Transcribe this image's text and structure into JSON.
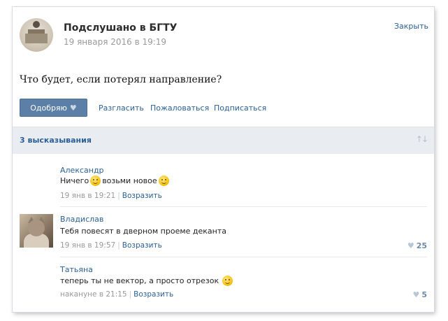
{
  "post": {
    "group_name": "Подслушано в БГТУ",
    "date": "19 января 2016 в 19:19",
    "close_label": "Закрыть",
    "text": "Что будет, если потерял направление?",
    "like_label": "Одобряю",
    "actions": [
      "Разгласить",
      "Пожаловаться",
      "Подписаться"
    ]
  },
  "comments_header": {
    "count_label": "3 высказывания"
  },
  "comments": [
    {
      "author": "Александр",
      "text_before": "Ничего",
      "text_after": "возьми новое",
      "time": "19 янв в 19:21",
      "reply": "Возразить",
      "likes": ""
    },
    {
      "author": "Владислав",
      "text": "Тебя повесят в дверном проеме деканта",
      "time": "19 янв в 19:57",
      "reply": "Возразить",
      "likes": "25"
    },
    {
      "author": "Татьяна",
      "text": "теперь ты не вектор, а просто отрезок",
      "time": "накануне в 21:15",
      "reply": "Возразить",
      "likes": "5"
    }
  ],
  "colors": {
    "accent": "#2b5f94",
    "like_button": "#5b7fa6",
    "bar": "#e9edf1"
  },
  "icons": {
    "heart": "heart-icon",
    "sort": "sort-icon",
    "smile": "smile-icon"
  }
}
